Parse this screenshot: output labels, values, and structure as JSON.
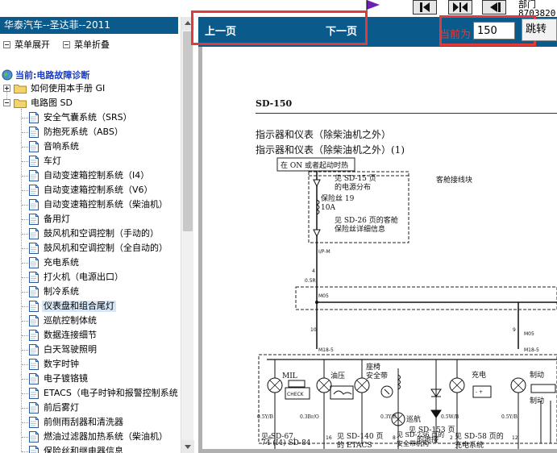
{
  "top_info": "部门\n8703820",
  "left_panel": {
    "title": "华泰汽车--圣达菲--2011",
    "expand_label": "菜单展开",
    "collapse_label": "菜单折叠",
    "current_label": "当前:电路故障诊断",
    "tree": [
      {
        "label": "如何使用本手册 GI",
        "type": "folder",
        "expander": "plus"
      },
      {
        "label": "电路图 SD",
        "type": "folder",
        "expander": "minus"
      },
      {
        "label": "安全气囊系统（SRS）",
        "type": "doc"
      },
      {
        "label": "防抱死系统（ABS）",
        "type": "doc"
      },
      {
        "label": "音响系统",
        "type": "doc"
      },
      {
        "label": "车灯",
        "type": "doc"
      },
      {
        "label": "自动变速箱控制系统（I4）",
        "type": "doc"
      },
      {
        "label": "自动变速箱控制系统（V6）",
        "type": "doc"
      },
      {
        "label": "自动变速箱控制系统（柴油机）",
        "type": "doc"
      },
      {
        "label": "备用灯",
        "type": "doc"
      },
      {
        "label": "鼓风机和空调控制（手动的）",
        "type": "doc"
      },
      {
        "label": "鼓风机和空调控制（全自动的）",
        "type": "doc"
      },
      {
        "label": "充电系统",
        "type": "doc"
      },
      {
        "label": "打火机（电源出口）",
        "type": "doc"
      },
      {
        "label": "制冷系统",
        "type": "doc"
      },
      {
        "label": "仪表盘和组合尾灯",
        "type": "doc",
        "selected": true
      },
      {
        "label": "巡航控制体统",
        "type": "doc"
      },
      {
        "label": "数据连接细节",
        "type": "doc"
      },
      {
        "label": "白天驾驶照明",
        "type": "doc"
      },
      {
        "label": "数字时钟",
        "type": "doc"
      },
      {
        "label": "电子镀铬镜",
        "type": "doc"
      },
      {
        "label": "ETACS（电子时钟和报警控制系统",
        "type": "doc"
      },
      {
        "label": "前后雾灯",
        "type": "doc"
      },
      {
        "label": "前侧雨刮器和清洗器",
        "type": "doc"
      },
      {
        "label": "燃油过滤器加热系统（柴油机）",
        "type": "doc"
      },
      {
        "label": "保险丝和继电器信息",
        "type": "doc"
      }
    ]
  },
  "toolbar": {
    "prev_label": "上一页",
    "next_label": "下一页",
    "current_page_label": "当前为",
    "current_page_value": "150",
    "jump_label": "跳转"
  },
  "document": {
    "code": "SD-150",
    "title_line1": "指示器和仪表（除柴油机之外）",
    "title_line2": "指示器和仪表（除柴油机之外）(1)",
    "diagram": {
      "top_box": "在 ON 或者起动时热",
      "note_sd15": "见 SD-15 页",
      "note_power": "的电源分布",
      "cabin_junction": "客舱接线块",
      "fuse": "保险丝 19",
      "fuse_rating": "10A",
      "note_sd26": "见 SD-26 页的客舱",
      "note_fuse_detail": "保险丝详细信息",
      "wire_color_top": "0.5R",
      "conn_ip": "I/P-M",
      "conn_m05": "M05",
      "conn_m05b": "M05",
      "pin_4": "4",
      "pin_10": "10",
      "pin_9": "9",
      "conn_m185": "M18-5",
      "conn_m185b": "M18-5",
      "mil": "MIL",
      "check": "CHECK",
      "oil": "油压",
      "seatbelt": "座椅",
      "seatbelt2": "安全带",
      "charge": "充电",
      "brake": "制动",
      "brake2": "制动",
      "glow": "巡航",
      "note_sd153": "见 SD-153 页",
      "note_ground": "的地接",
      "pin_6": "6",
      "pin_16": "16",
      "pin_8": "8",
      "pin_2": "2",
      "pin_12": "12",
      "pin_12b": "12",
      "wire_05yb": "0.5Y/B",
      "wire_03brd": "0.3Br/O",
      "wire_03yb": "0.3Y/B",
      "wire_05wb": "0.5W/B",
      "wire_05yb2": "0.5Y/B",
      "note_sd67": "见 SD-67,",
      "note_sd84": "74 (I4) SD-84",
      "note_sd140": "见 SD-140 页",
      "note_etacs": "的 ETACS",
      "note_sd236": "见 SD-236 页的",
      "note_sd236b": "安全带机构",
      "note_sd58": "见 SD-58 页的",
      "note_sd58b": "充电系统"
    }
  }
}
